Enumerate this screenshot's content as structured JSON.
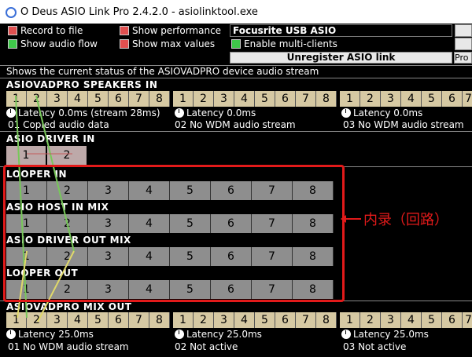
{
  "window": {
    "title": "O Deus ASIO Link Pro 2.4.2.0 - asiolinktool.exe"
  },
  "options": {
    "record_to_file": "Record to file",
    "show_performance": "Show performance",
    "show_audio_flow": "Show audio flow",
    "show_max_values": "Show max values",
    "enable_multi_clients": "Enable multi-clients",
    "device": "Focusrite USB ASIO",
    "unregister": "Unregister ASIO link",
    "pro_button": "Pro"
  },
  "status_text": "Shows the current status of the ASIOVADPRO device audio stream",
  "speakers_in": {
    "title": "ASIOVADPRO SPEAKERS IN",
    "channels": [
      "1",
      "2",
      "3",
      "4",
      "5",
      "6",
      "7",
      "8"
    ],
    "streams": [
      {
        "latency": "Latency 0.0ms (stream 28ms)",
        "label": "01 Copied audio data"
      },
      {
        "latency": "Latency 0.0ms",
        "label": "02 No WDM audio stream"
      },
      {
        "latency": "Latency 0.0ms",
        "label": "03 No WDM audio stream"
      }
    ]
  },
  "driver_in": {
    "title": "ASIO DRIVER IN",
    "channels": [
      "1",
      "2"
    ]
  },
  "looper_in": {
    "title": "LOOPER IN",
    "channels": [
      "1",
      "2",
      "3",
      "4",
      "5",
      "6",
      "7",
      "8"
    ]
  },
  "host_in_mix": {
    "title": "ASIO HOST IN MIX",
    "channels": [
      "1",
      "2",
      "3",
      "4",
      "5",
      "6",
      "7",
      "8"
    ]
  },
  "driver_out_mix": {
    "title": "ASIO DRIVER OUT MIX",
    "channels": [
      "1",
      "2",
      "3",
      "4",
      "5",
      "6",
      "7",
      "8"
    ]
  },
  "looper_out": {
    "title": "LOOPER OUT",
    "channels": [
      "1",
      "2",
      "3",
      "4",
      "5",
      "6",
      "7",
      "8"
    ]
  },
  "mix_out": {
    "title": "ASIOVADPRO MIX OUT",
    "channels": [
      "1",
      "2",
      "3",
      "4",
      "5",
      "6",
      "7",
      "8"
    ],
    "streams": [
      {
        "latency": "Latency 25.0ms",
        "label": "01 No WDM audio stream"
      },
      {
        "latency": "Latency 25.0ms",
        "label": "02 Not active"
      },
      {
        "latency": "Latency 25.0ms",
        "label": "03 Not active"
      }
    ]
  },
  "annotation": "内录（回路）",
  "colors": {
    "annotation": "#e21a1a",
    "record": "#e05050",
    "flow": "#3fc74a"
  }
}
